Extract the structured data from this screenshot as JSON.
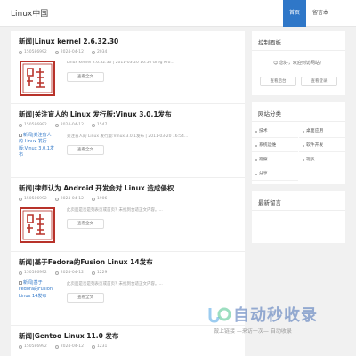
{
  "header": {
    "logo": "Linux中国",
    "nav": [
      "首页",
      "留言本"
    ]
  },
  "posts": [
    {
      "title": "新闻|Linux kernel 2.6.32.30",
      "author": "150586992",
      "date": "2024-04-12",
      "views": "2034",
      "excerpt": "Linux kernel 2.6.32.30 | 2011-03-20 16:50 Greg Kro...",
      "image": "seal",
      "alt": ""
    },
    {
      "title": "新闻|关注盲人的 Linux 发行版:Vinux 3.0.1发布",
      "author": "150586992",
      "date": "2024-04-12",
      "views": "1547",
      "excerpt": "关注盲人的 Linux 发行版:Vinux 3.0.1发布 | 2011-03-20 16:54...",
      "image": "broken",
      "alt": "新闻|关注盲人的 Linux 发行版:Vinux 3.0.1发布"
    },
    {
      "title": "新闻|律师认为 Android 开发会对 Linux 造成侵权",
      "author": "150586992",
      "date": "2024-04-12",
      "views": "1906",
      "excerpt": "此页面是否是列表页或首页？未找到合适正文内容。...",
      "image": "seal",
      "alt": ""
    },
    {
      "title": "新闻|基于Fedora的Fusion Linux 14发布",
      "author": "150586992",
      "date": "2024-04-12",
      "views": "1229",
      "excerpt": "此页面是否是列表页或首页？未找到合适正文内容。...",
      "image": "broken",
      "alt": "新闻|基于Fedora的Fusion Linux 14发布"
    },
    {
      "title": "新闻|Gentoo Linux 11.0 发布",
      "author": "150586992",
      "date": "2024-04-12",
      "views": "1231",
      "excerpt": "",
      "image": "none",
      "alt": ""
    }
  ],
  "read_more": "查看全文",
  "sidebar": {
    "control_title": "控制面板",
    "greeting": "您好，欢迎到访网站！",
    "login_btn": "查看后台",
    "logout_btn": "查看登录",
    "category_title": "网站分类",
    "categories": [
      "技术",
      "桌面应用",
      "系统运维",
      "软件开发",
      "观察",
      "现状",
      "分享"
    ],
    "recent_title": "最新留言"
  },
  "watermark": {
    "main": "自动秒收录",
    "sub": "做上链接 —来访一次— 自动收录"
  },
  "colors": {
    "accent": "#2f77c8",
    "seal_red": "#b8322a"
  }
}
